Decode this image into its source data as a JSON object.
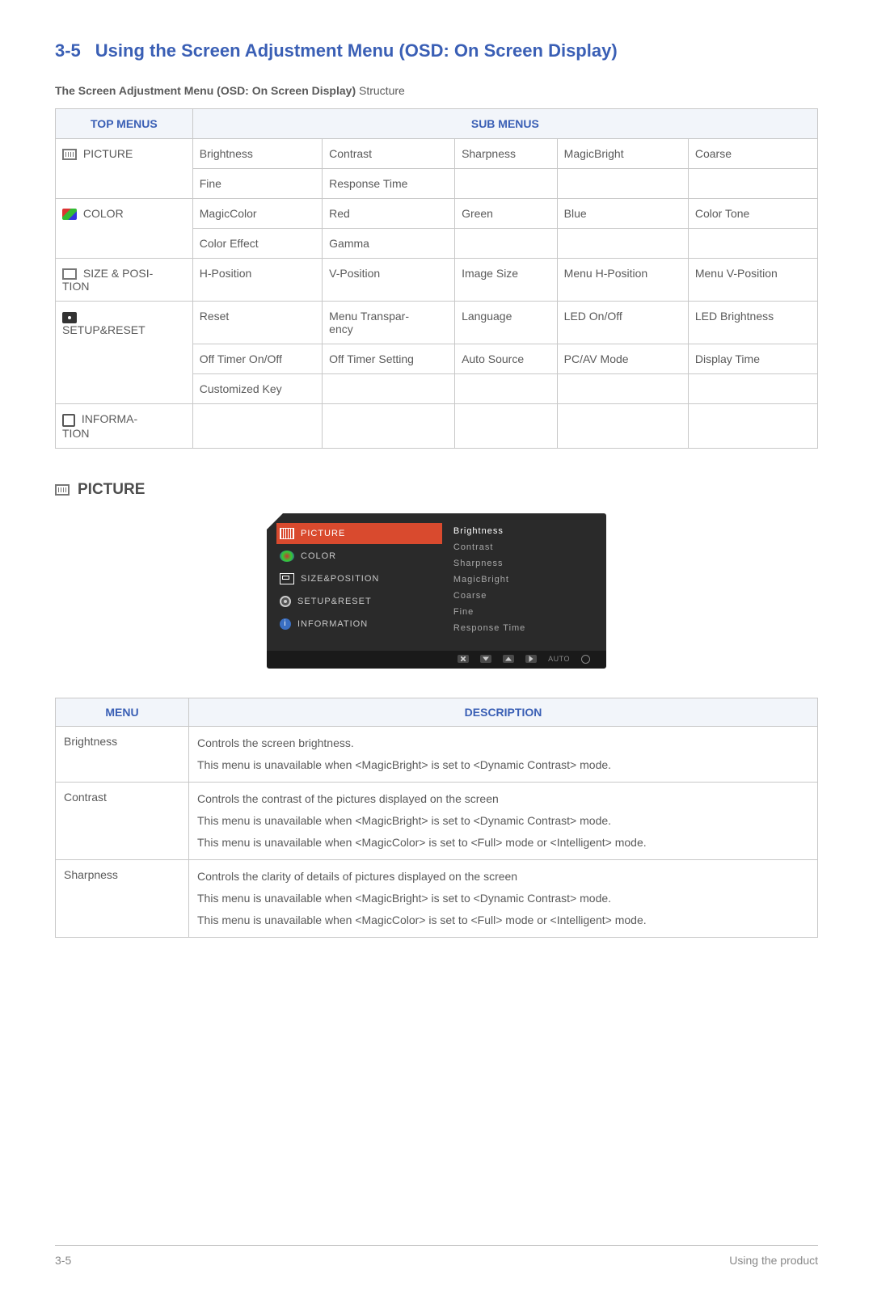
{
  "heading": {
    "num": "3-5",
    "title": "Using the Screen Adjustment Menu (OSD: On Screen Display)"
  },
  "structure_caption_bold": "The Screen Adjustment Menu (OSD: On Screen Display)",
  "structure_caption_rest": " Structure",
  "table1": {
    "headers": {
      "top": "TOP MENUS",
      "sub": "SUB MENUS"
    },
    "rows": {
      "picture": {
        "label": "PICTURE",
        "r1": [
          "Brightness",
          "Contrast",
          "Sharpness",
          "MagicBright",
          "Coarse"
        ],
        "r2": [
          "Fine",
          "Response Time",
          "",
          "",
          ""
        ]
      },
      "color": {
        "label": "COLOR",
        "r1": [
          "MagicColor",
          "Red",
          "Green",
          "Blue",
          "Color Tone"
        ],
        "r2": [
          "Color Effect",
          "Gamma",
          "",
          "",
          ""
        ]
      },
      "size": {
        "label": "SIZE & POSITION",
        "r1": [
          "H-Position",
          "V-Position",
          "Image Size",
          "Menu H-Position",
          "Menu V-Position"
        ]
      },
      "setup": {
        "label": "SETUP&RESET",
        "r1": [
          "Reset",
          "Menu Transparency",
          "Language",
          "LED On/Off",
          "LED Brightness"
        ],
        "r2": [
          "Off Timer On/Off",
          "Off Timer Setting",
          "Auto Source",
          "PC/AV Mode",
          "Display Time"
        ],
        "r3": [
          "Customized Key",
          "",
          "",
          "",
          ""
        ]
      },
      "info": {
        "label": "INFORMATION",
        "r1": [
          "",
          "",
          "",
          "",
          ""
        ]
      }
    }
  },
  "picture_section_heading": "PICTURE",
  "osd": {
    "left": [
      "PICTURE",
      "COLOR",
      "SIZE&POSITION",
      "SETUP&RESET",
      "INFORMATION"
    ],
    "right": [
      "Brightness",
      "Contrast",
      "Sharpness",
      "MagicBright",
      "Coarse",
      "Fine",
      "Response Time"
    ],
    "footer_auto": "AUTO"
  },
  "table2": {
    "headers": {
      "menu": "MENU",
      "desc": "DESCRIPTION"
    },
    "rows": [
      {
        "menu": "Brightness",
        "lines": [
          "Controls the screen brightness.",
          "This menu is unavailable when <MagicBright> is set to <Dynamic Contrast> mode."
        ]
      },
      {
        "menu": "Contrast",
        "lines": [
          "Controls the contrast of the pictures displayed on the screen",
          "This menu is unavailable when <MagicBright> is set to <Dynamic Contrast> mode.",
          "This menu is unavailable when <MagicColor> is set to <Full> mode or <Intelligent> mode."
        ]
      },
      {
        "menu": "Sharpness",
        "lines": [
          "Controls the clarity of details of pictures displayed on the screen",
          "This menu is unavailable when <MagicBright> is set to <Dynamic Contrast> mode.",
          "This menu is unavailable when <MagicColor> is set to <Full> mode or <Intelligent> mode."
        ]
      }
    ]
  },
  "footer": {
    "left": "3-5",
    "right": "Using the product"
  }
}
